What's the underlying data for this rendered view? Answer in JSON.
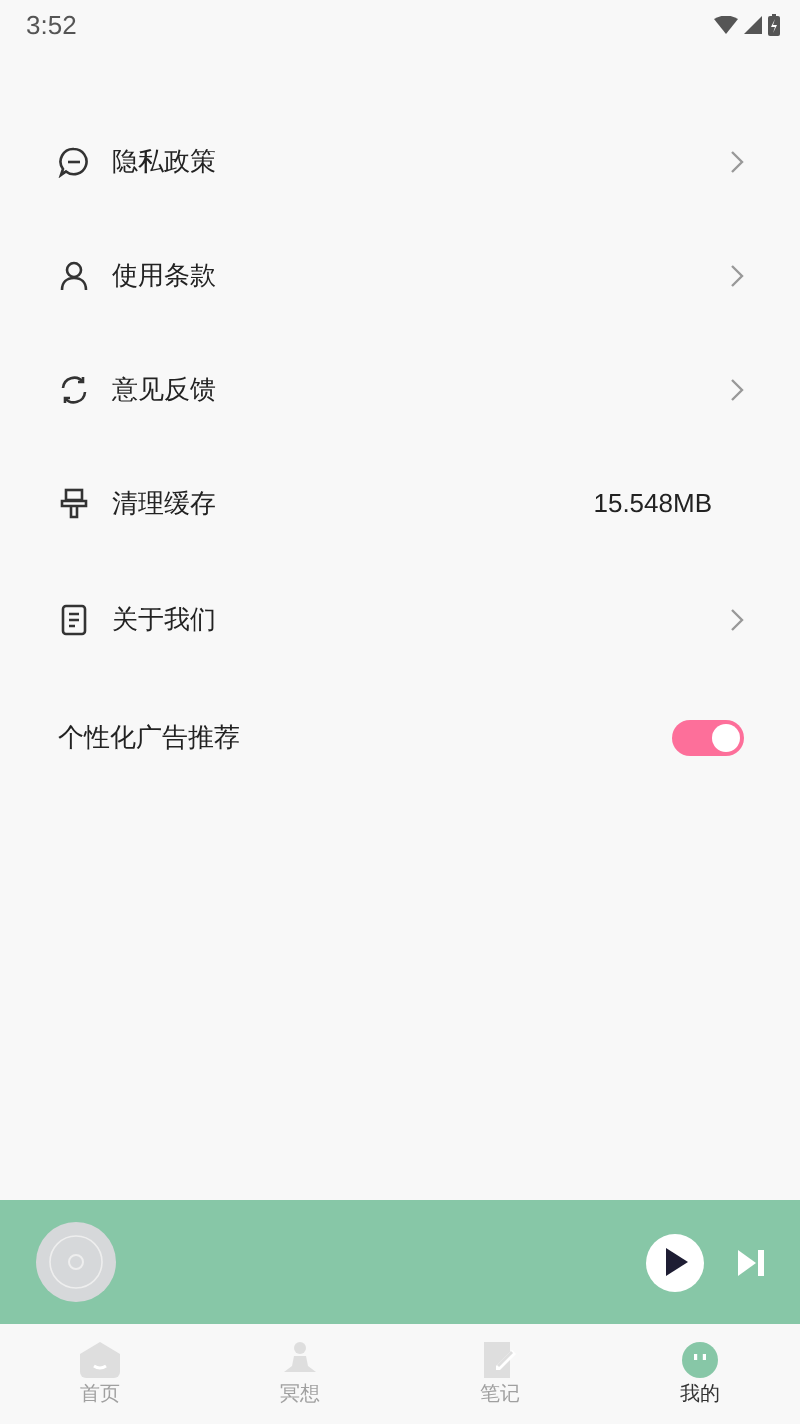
{
  "status_bar": {
    "time": "3:52"
  },
  "settings": [
    {
      "kind": "link",
      "label": "隐私政策"
    },
    {
      "kind": "link",
      "label": "使用条款"
    },
    {
      "kind": "link",
      "label": "意见反馈"
    },
    {
      "kind": "value",
      "label": "清理缓存",
      "value": "15.548MB"
    },
    {
      "kind": "link",
      "label": "关于我们"
    },
    {
      "kind": "toggle",
      "label": "个性化广告推荐",
      "on": true
    }
  ],
  "player": {
    "playing": false
  },
  "tabs": [
    {
      "label": "首页",
      "selected": false
    },
    {
      "label": "冥想",
      "selected": false
    },
    {
      "label": "笔记",
      "selected": false
    },
    {
      "label": "我的",
      "selected": true
    }
  ]
}
